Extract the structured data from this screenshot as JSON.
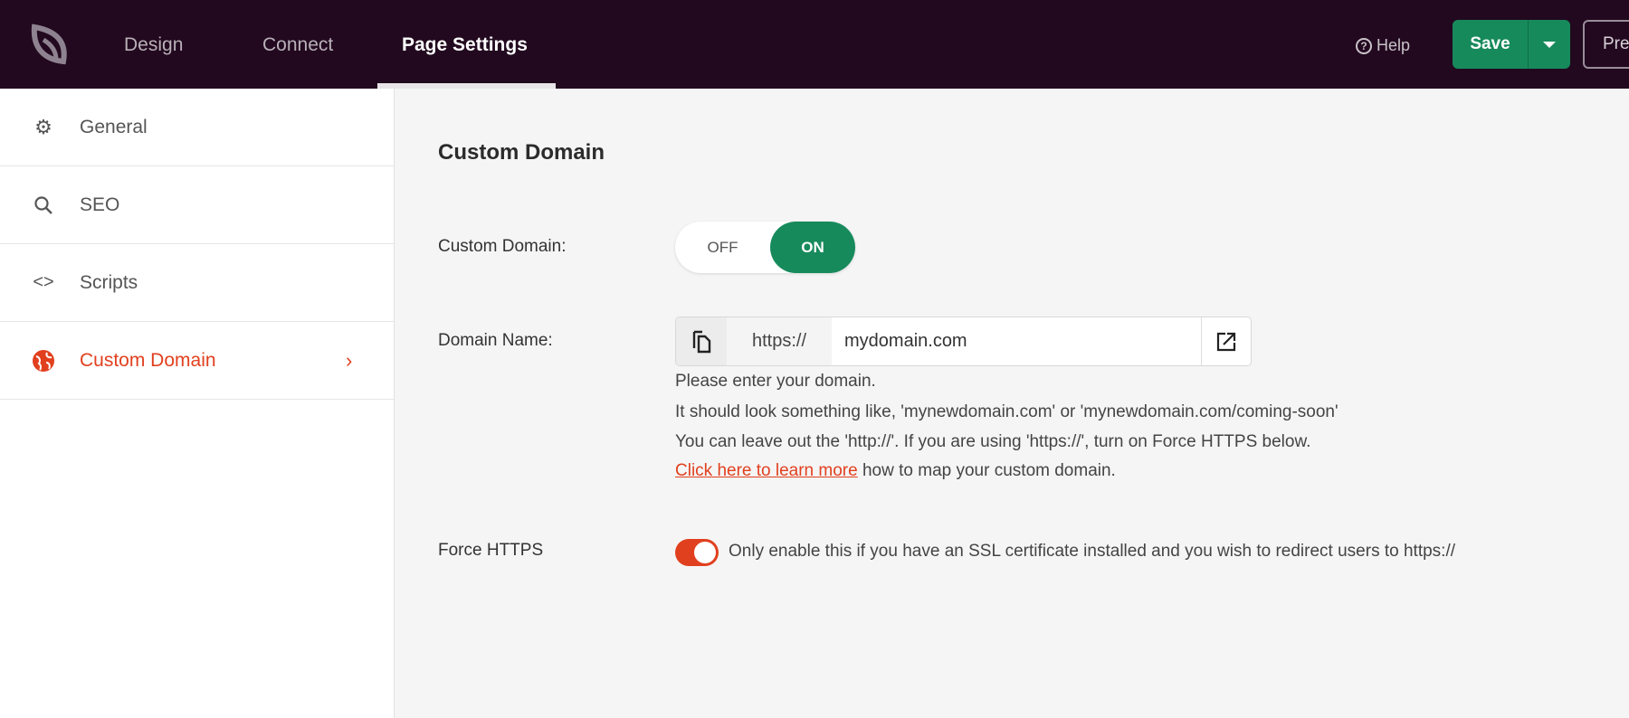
{
  "topbar": {
    "tabs": [
      {
        "label": "Design"
      },
      {
        "label": "Connect"
      },
      {
        "label": "Page Settings"
      }
    ],
    "help_label": "Help",
    "save_label": "Save",
    "preview_label": "Pre"
  },
  "sidebar": {
    "items": [
      {
        "label": "General",
        "icon": "gear-icon"
      },
      {
        "label": "SEO",
        "icon": "search-icon"
      },
      {
        "label": "Scripts",
        "icon": "code-icon"
      },
      {
        "label": "Custom Domain",
        "icon": "globe-icon",
        "active": true
      }
    ]
  },
  "main": {
    "heading": "Custom Domain",
    "custom_domain_label": "Custom Domain:",
    "toggle": {
      "off": "OFF",
      "on": "ON",
      "value": "ON"
    },
    "domain_label": "Domain Name:",
    "protocol": "https://",
    "domain_value": "mydomain.com",
    "hints": [
      "Please enter your domain.",
      "It should look something like, 'mynewdomain.com' or 'mynewdomain.com/coming-soon'",
      "You can leave out the 'http://'. If you are using 'https://', turn on Force HTTPS below."
    ],
    "learn_link": "Click here to learn more",
    "learn_suffix": " how to map your custom domain.",
    "force_https_label": "Force HTTPS",
    "force_https_on": true,
    "force_https_text": "Only enable this if you have an SSL certificate installed and you wish to redirect users to https://"
  },
  "colors": {
    "topbar": "#22091f",
    "accent_green": "#178a5c",
    "accent_orange": "#e1401f"
  }
}
